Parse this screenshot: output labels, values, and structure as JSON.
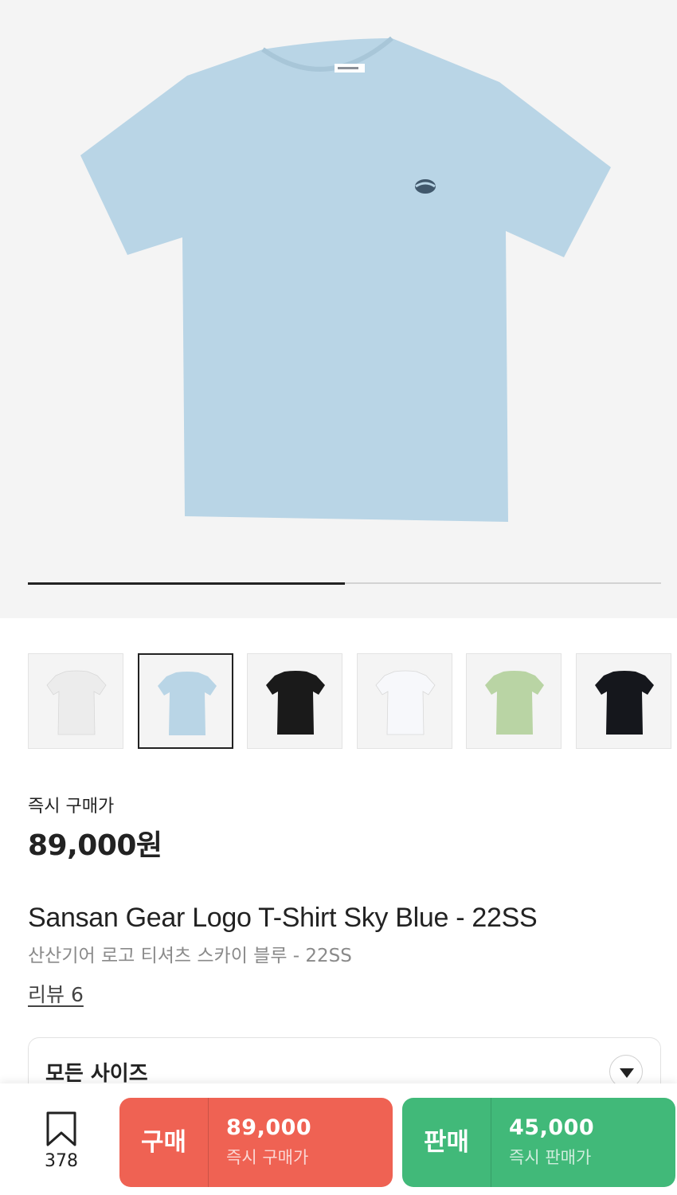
{
  "hero": {
    "product_color": "#b9d5e6",
    "gallery_progress": 0.5
  },
  "thumbnails": [
    {
      "name": "white-logo",
      "color": "#ececec",
      "selected": false
    },
    {
      "name": "sky-blue",
      "color": "#b9d5e6",
      "selected": true
    },
    {
      "name": "black",
      "color": "#1a1a1a",
      "selected": false
    },
    {
      "name": "white",
      "color": "#f7f8fb",
      "selected": false
    },
    {
      "name": "mint",
      "color": "#b9d4a4",
      "selected": false
    },
    {
      "name": "navy-black",
      "color": "#15171c",
      "selected": false
    }
  ],
  "price": {
    "label": "즉시 구매가",
    "value": "89,000원"
  },
  "product": {
    "title_en": "Sansan Gear Logo T-Shirt Sky Blue - 22SS",
    "title_ko": "산산기어 로고 티셔츠 스카이 블루 - 22SS",
    "review_link": "리뷰 6"
  },
  "size_select": {
    "label": "모든 사이즈",
    "icon": "triangle-down-icon"
  },
  "bottom_bar": {
    "bookmark_icon": "bookmark-icon",
    "bookmark_count": "378",
    "buy": {
      "label": "구매",
      "amount": "89,000",
      "sub": "즉시 구매가",
      "color": "#ef6253"
    },
    "sell": {
      "label": "판매",
      "amount": "45,000",
      "sub": "즉시 판매가",
      "color": "#41b979"
    }
  }
}
